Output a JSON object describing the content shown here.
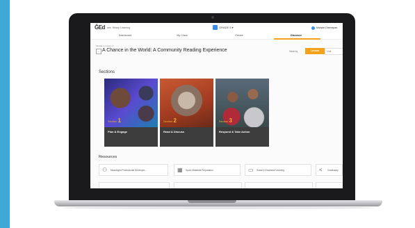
{
  "topbar": {
    "logo": "ĜEd",
    "logo_sub": "see. Ready. Learning",
    "product": "GRADE 5 ▾",
    "user": "Michael Greenspan"
  },
  "nav": {
    "tabs": [
      "Dashboard",
      "My Class",
      "Create",
      "Discover"
    ],
    "active_tab": "Discover"
  },
  "header": {
    "breadcrumb": "Module 1 Lesson 1",
    "back": "←",
    "title": "A Chance in the World: A Community Reading Experience",
    "view_by_label": "View by",
    "view_options": [
      "Lesson",
      "Unit"
    ]
  },
  "sections": {
    "heading": "Sections",
    "cards": [
      {
        "num_prefix": "Section",
        "num": "1",
        "label": "Plan & Engage"
      },
      {
        "num_prefix": "Section",
        "num": "2",
        "label": "Read & Discuss"
      },
      {
        "num_prefix": "Section",
        "num": "3",
        "label": "Respond & Take Action"
      }
    ]
  },
  "resources": {
    "heading": "Resources",
    "items": [
      {
        "icon": "people-icon",
        "label": "Meaningful Professional Developm..."
      },
      {
        "icon": "book-icon",
        "label": "Spore Materials Preparation"
      },
      {
        "icon": "document-icon",
        "label": "Social & Emotional Learning"
      },
      {
        "icon": "share-icon",
        "label": "Vocabulary"
      }
    ]
  },
  "colors": {
    "accent": "#f3a21a",
    "background": "#3fa9d6"
  }
}
